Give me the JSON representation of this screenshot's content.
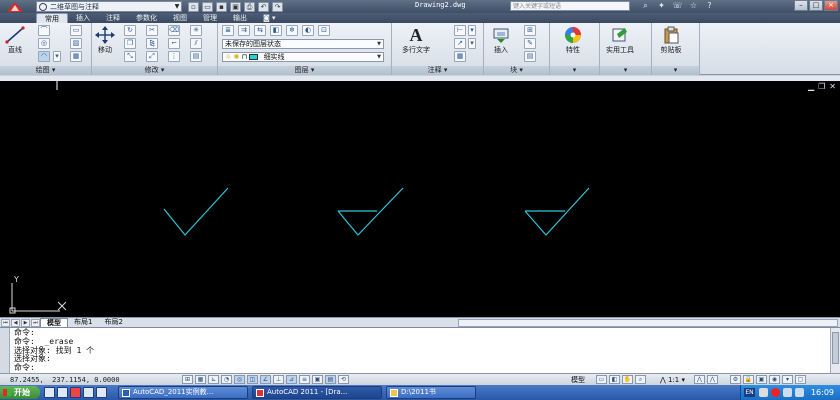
{
  "title_bar": {
    "workspace": "二维草图与注释",
    "doc_title": "Drawing2.dwg",
    "search_placeholder": "键入关键字或短语"
  },
  "ribbon": {
    "tabs": [
      "常用",
      "插入",
      "注释",
      "参数化",
      "视图",
      "管理",
      "输出"
    ],
    "active_tab": "常用",
    "draw": {
      "line_label": "直线",
      "footer": "绘图 ▾"
    },
    "modify": {
      "move_label": "移动",
      "footer": "修改 ▾"
    },
    "layers": {
      "layer_state": "未保存的图层状态",
      "current_layer": "细实线",
      "footer": "图层 ▾"
    },
    "annotation": {
      "mtext_label": "多行文字",
      "footer": "注释 ▾"
    },
    "block": {
      "insert_label": "插入",
      "footer": "块 ▾"
    },
    "properties": {
      "label": "特性",
      "footer": "▾"
    },
    "utilities": {
      "label": "实用工具",
      "footer": "▾"
    },
    "clipboard": {
      "label": "剪贴板",
      "footer": "▾"
    }
  },
  "drawing": {
    "background": "#000000",
    "line_color": "#2fc6d8",
    "ucs_y": "Y",
    "ucs_x": "X"
  },
  "layout_tabs": [
    "模型",
    "布局1",
    "布局2"
  ],
  "command_window": {
    "lines": [
      "命令:",
      "命令:  _erase",
      "选择对象: 找到 1 个",
      "选择对象:",
      "命令:"
    ]
  },
  "status": {
    "coords": "87.2455,  237.1154, 0.0000",
    "model": "模型",
    "scale": "1:1"
  },
  "taskbar": {
    "start": "开始",
    "items": [
      "AutoCAD_2011实例教...",
      "AutoCAD 2011 - [Dra...",
      "D:\\2011书"
    ],
    "lang": "EN",
    "clock": "16:09"
  }
}
